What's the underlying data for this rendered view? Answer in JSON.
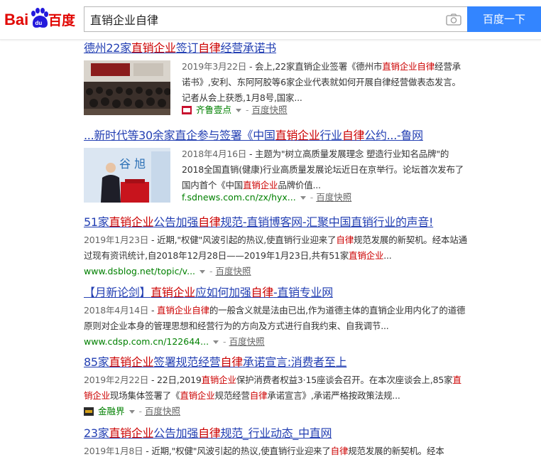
{
  "search": {
    "query": "直销企业自律",
    "button_label": "百度一下"
  },
  "results": [
    {
      "title_parts": [
        {
          "t": "德州22家",
          "em": false
        },
        {
          "t": "直销企业",
          "em": true
        },
        {
          "t": "签订",
          "em": false
        },
        {
          "t": "自律",
          "em": true
        },
        {
          "t": "经营承诺书",
          "em": false
        }
      ],
      "date": "2019年3月22日",
      "abstract_parts": [
        {
          "t": " - 会上,22家直销企业签署《德州市",
          "em": false
        },
        {
          "t": "直销企业自律",
          "em": true
        },
        {
          "t": "经营承诺书》,安利、东阿阿胶等6家企业代表就如何开展自律经营做表态发言。 记者从会上获悉,1月8号,国家...",
          "em": false
        }
      ],
      "source": "齐鲁壹点",
      "snapshot": "百度快照"
    },
    {
      "title_parts": [
        {
          "t": "...新时代等30余家直企参与签署《中国",
          "em": false
        },
        {
          "t": "直销企业",
          "em": true
        },
        {
          "t": "行业",
          "em": false
        },
        {
          "t": "自律",
          "em": true
        },
        {
          "t": "公约...-鲁网",
          "em": false
        }
      ],
      "date": "2018年4月16日",
      "abstract_parts": [
        {
          "t": " - 主题为\"树立高质量发展理念 塑造行业知名品牌\"的2018全国直销(健康)行业高质量发展论坛近日在京举行。论坛首次发布了国内首个《中国",
          "em": false
        },
        {
          "t": "直销企业",
          "em": true
        },
        {
          "t": "品牌价值...",
          "em": false
        }
      ],
      "url": "f.sdnews.com.cn/zx/hyx...",
      "snapshot": "百度快照",
      "thumb_text": "谷 旭"
    },
    {
      "title_parts": [
        {
          "t": "51家",
          "em": false
        },
        {
          "t": "直销企业",
          "em": true
        },
        {
          "t": "公告加强",
          "em": false
        },
        {
          "t": "自律",
          "em": true
        },
        {
          "t": "规范-直销博客网-汇聚中国直销行业的声音!",
          "em": false
        }
      ],
      "date": "2019年1月23日",
      "abstract_parts": [
        {
          "t": " - 近期,\"权健\"风波引起的热议,使直销行业迎来了",
          "em": false
        },
        {
          "t": "自律",
          "em": true
        },
        {
          "t": "规范发展的新契机。经本站通过现有资讯统计,自2018年12月28日——2019年1月23日,共有51家",
          "em": false
        },
        {
          "t": "直销企业",
          "em": true
        },
        {
          "t": "...",
          "em": false
        }
      ],
      "url": "www.dsblog.net/topic/v...",
      "snapshot": "百度快照"
    },
    {
      "title_parts": [
        {
          "t": "【月新论剑】",
          "em": false
        },
        {
          "t": "直销企业",
          "em": true
        },
        {
          "t": "应如何加强",
          "em": false
        },
        {
          "t": "自律",
          "em": true
        },
        {
          "t": "-直销专业网",
          "em": false
        }
      ],
      "date": "2018年4月14日",
      "abstract_parts": [
        {
          "t": " - ",
          "em": false
        },
        {
          "t": "直销企业自律",
          "em": true
        },
        {
          "t": "的一般含义就是法由已出,作为道德主体的直销企业用内化了的道德原则对企业本身的管理思想和经营行为的方向及方式进行自我约束、自我调节...",
          "em": false
        }
      ],
      "url": "www.cdsp.com.cn/122644...",
      "snapshot": "百度快照"
    },
    {
      "title_parts": [
        {
          "t": "85家",
          "em": false
        },
        {
          "t": "直销企业",
          "em": true
        },
        {
          "t": "签署规范经营",
          "em": false
        },
        {
          "t": "自律",
          "em": true
        },
        {
          "t": "承诺宣言:消费者至上",
          "em": false
        }
      ],
      "date": "2019年2月22日",
      "abstract_parts": [
        {
          "t": " - 22日,2019",
          "em": false
        },
        {
          "t": "直销企业",
          "em": true
        },
        {
          "t": "保护消费者权益3·15座谈会召开。在本次座谈会上,85家",
          "em": false
        },
        {
          "t": "直销企业",
          "em": true
        },
        {
          "t": "现场集体签署了《",
          "em": false
        },
        {
          "t": "直销企业",
          "em": true
        },
        {
          "t": "规范经营",
          "em": false
        },
        {
          "t": "自律",
          "em": true
        },
        {
          "t": "承诺宣言》,承诺严格按政策法规...",
          "em": false
        }
      ],
      "source": "金融界",
      "snapshot": "百度快照"
    },
    {
      "title_parts": [
        {
          "t": "23家",
          "em": false
        },
        {
          "t": "直销企业",
          "em": true
        },
        {
          "t": "公告加强",
          "em": false
        },
        {
          "t": "自律",
          "em": true
        },
        {
          "t": "规范_行业动态_中直网",
          "em": false
        }
      ],
      "date": "2019年1月8日",
      "abstract_parts": [
        {
          "t": " - 近期,\"权健\"风波引起的热议,使直销行业迎来了",
          "em": false
        },
        {
          "t": "自律",
          "em": true
        },
        {
          "t": "规范发展的新契机。经本",
          "em": false
        }
      ]
    }
  ],
  "colors": {
    "link": "#2440b3",
    "highlight": "#cc0000",
    "url": "#008000",
    "button": "#3385ff"
  }
}
